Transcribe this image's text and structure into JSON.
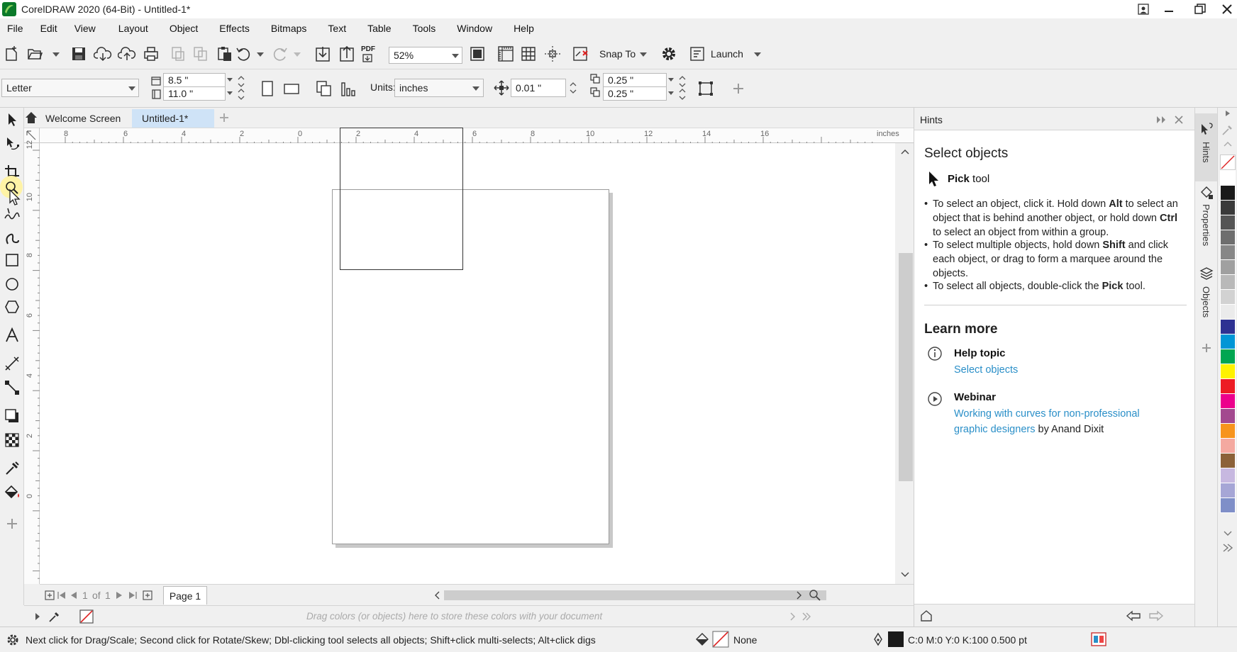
{
  "window": {
    "title": "CorelDRAW 2020 (64-Bit) - Untitled-1*"
  },
  "menu": [
    "File",
    "Edit",
    "View",
    "Layout",
    "Object",
    "Effects",
    "Bitmaps",
    "Text",
    "Table",
    "Tools",
    "Window",
    "Help"
  ],
  "std_toolbar": {
    "zoom": "52%",
    "pdf_label": "PDF",
    "snap_to": "Snap To",
    "launch": "Launch"
  },
  "prop_toolbar": {
    "page_size": "Letter",
    "width": "8.5 \"",
    "height": "11.0 \"",
    "units_label": "Units:",
    "units": "inches",
    "nudge": "0.01 \"",
    "dup_x": "0.25 \"",
    "dup_y": "0.25 \""
  },
  "tabs": {
    "welcome": "Welcome Screen",
    "doc": "Untitled-1*"
  },
  "ruler": {
    "h_labels": [
      "8",
      "6",
      "4",
      "2",
      "0",
      "2",
      "4",
      "6",
      "8",
      "10",
      "12",
      "14",
      "16"
    ],
    "units": "inches",
    "v_labels": [
      "12",
      "10",
      "8",
      "6",
      "4",
      "2",
      "0"
    ]
  },
  "page_nav": {
    "current": "1",
    "of": "of",
    "total": "1",
    "page_tab": "Page 1"
  },
  "doc_palette": {
    "hint": "Drag colors (or objects) here to store these colors with your document"
  },
  "hints": {
    "header": "Hints",
    "title": "Select objects",
    "tool_name": "Pick",
    "tool_suffix": "tool",
    "bullet1": {
      "p1": "To select an object, click it. Hold down ",
      "b1": "Alt",
      "p2": " to select an object that is behind another object, or hold down ",
      "b2": "Ctrl",
      "p3": " to select an object from within a group."
    },
    "bullet2": {
      "p1": "To select multiple objects, hold down ",
      "b1": "Shift",
      "p2": " and click each object, or drag to form a marquee around the objects."
    },
    "bullet3": {
      "p1": "To select all objects, double-click the ",
      "b1": "Pick",
      "p2": " tool."
    },
    "learn_more": "Learn more",
    "help_topic_label": "Help topic",
    "help_topic_link": "Select objects",
    "webinar_label": "Webinar",
    "webinar_link_line1": "Working with curves for non-professional",
    "webinar_link_line2": "graphic designers",
    "webinar_by": "by Anand Dixit"
  },
  "docker_tabs": [
    "Hints",
    "Properties",
    "Objects"
  ],
  "palette_colors": [
    "#ffffff",
    "#1a1a1a",
    "#3a3a3a",
    "#555555",
    "#6e6e6e",
    "#878787",
    "#a0a0a0",
    "#b9b9b9",
    "#d2d2d2",
    "#ebebeb",
    "#2e3192",
    "#0096d6",
    "#00a651",
    "#fff200",
    "#ed1c24",
    "#ec008c",
    "#a3498f",
    "#f7941d",
    "#f4a9a0",
    "#8c6239",
    "#c7b8e0",
    "#a6a6d6",
    "#7f8fc8"
  ],
  "status": {
    "message": "Next click for Drag/Scale; Second click for Rotate/Skew; Dbl-clicking tool selects all objects; Shift+click multi-selects; Alt+click digs",
    "fill": "None",
    "outline": "C:0 M:0 Y:0 K:100  0.500 pt"
  },
  "colors": {
    "accent": "#2a8fc8",
    "tab_active": "#cfe3f7",
    "highlight_tool": "#fff3a6"
  }
}
